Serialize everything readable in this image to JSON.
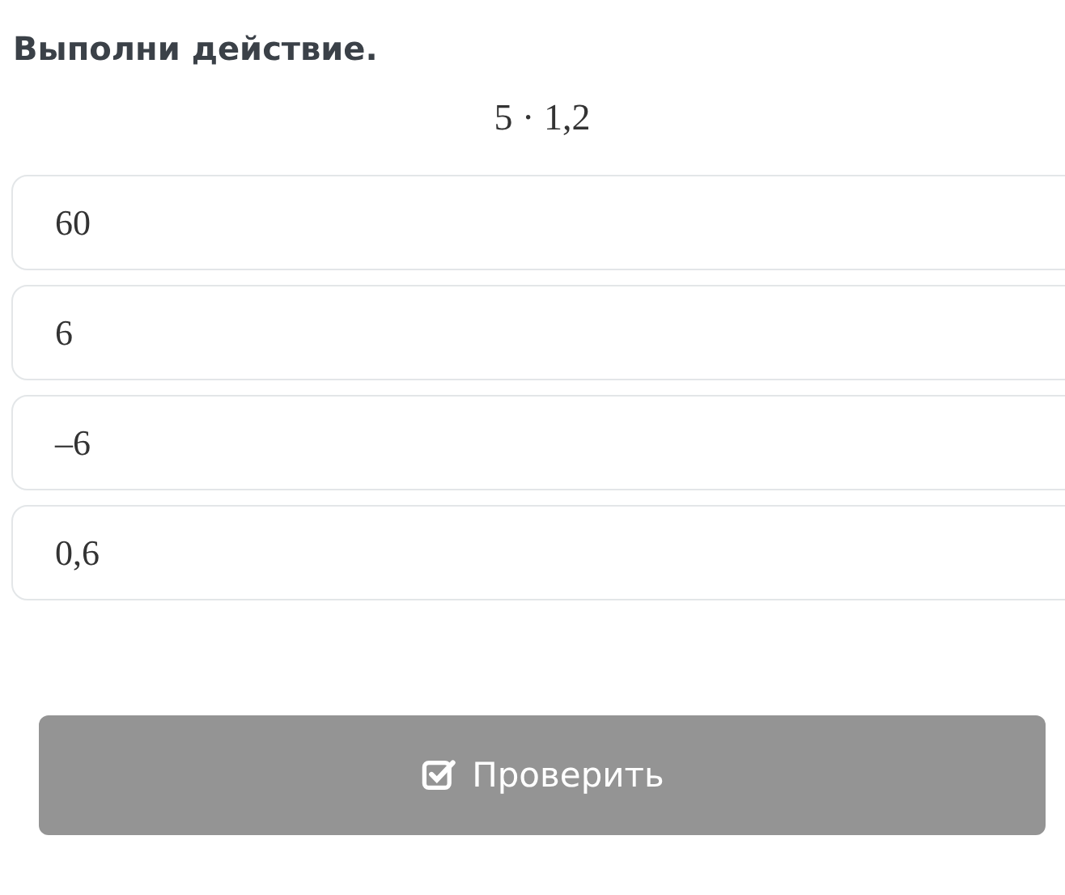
{
  "question": {
    "title": "Выполни действие.",
    "expression": "5 · 1,2"
  },
  "options": [
    {
      "label": "60",
      "selected": false
    },
    {
      "label": "6",
      "selected": false
    },
    {
      "label": "–6",
      "selected": false
    },
    {
      "label": "0,6",
      "selected": false
    }
  ],
  "check_button": {
    "label": "Проверить",
    "disabled": true
  }
}
